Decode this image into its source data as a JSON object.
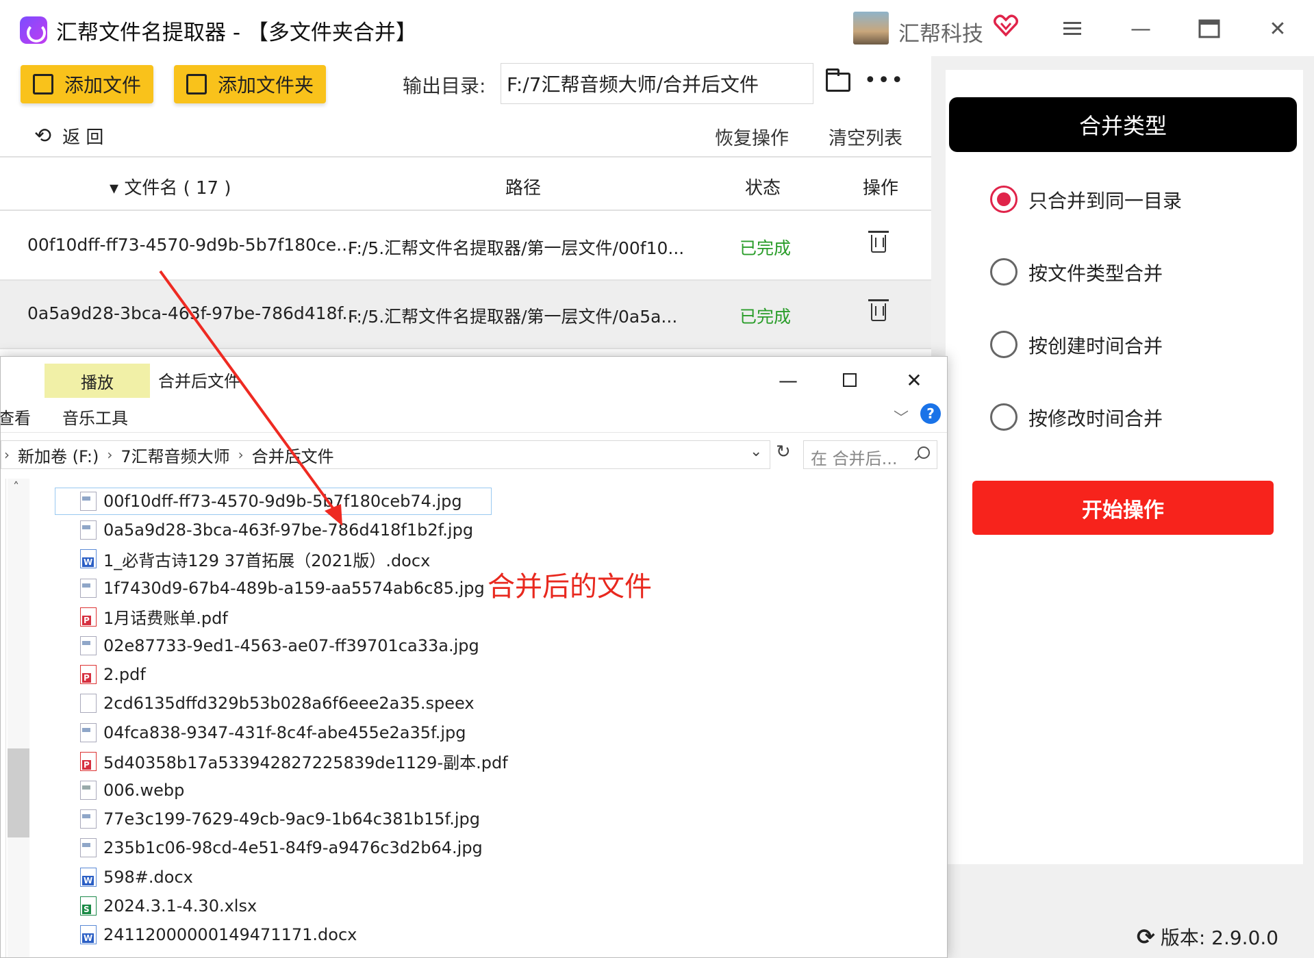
{
  "app": {
    "title": "汇帮文件名提取器 - 【多文件夹合并】",
    "brand": "汇帮科技",
    "window_minimize": "—",
    "window_close": "✕"
  },
  "toolbar": {
    "add_file": "添加文件",
    "add_folder": "添加文件夹",
    "output_label": "输出目录:",
    "output_path": "F:/7汇帮音频大师/合并后文件",
    "more": "•••",
    "back": "返  回",
    "restore": "恢复操作",
    "clear": "清空列表"
  },
  "table": {
    "headers": {
      "name": "▾ 文件名 ( 17 )",
      "path": "路径",
      "status": "状态",
      "action": "操作"
    },
    "rows": [
      {
        "name": "00f10dff-ff73-4570-9d9b-5b7f180ce...",
        "path": "F:/5.汇帮文件名提取器/第一层文件/00f10...",
        "status": "已完成"
      },
      {
        "name": "0a5a9d28-3bca-463f-97be-786d418f...",
        "path": "F:/5.汇帮文件名提取器/第一层文件/0a5a...",
        "status": "已完成"
      }
    ]
  },
  "right_panel": {
    "merge_type_title": "合并类型",
    "options": [
      {
        "label": "只合并到同一目录",
        "selected": true
      },
      {
        "label": "按文件类型合并",
        "selected": false
      },
      {
        "label": "按创建时间合并",
        "selected": false
      },
      {
        "label": "按修改时间合并",
        "selected": false
      }
    ],
    "start_button": "开始操作",
    "version": "版本: 2.9.0.0"
  },
  "explorer": {
    "tab_play": "播放",
    "tab_music_tools": "音乐工具",
    "tab_view": "查看",
    "window_title": "合并后文件",
    "window_minimize": "—",
    "window_close": "✕",
    "help": "?",
    "breadcrumb": [
      "新加卷 (F:)",
      "7汇帮音频大师",
      "合并后文件"
    ],
    "search_placeholder": "在 合并后...",
    "files": [
      {
        "name": "00f10dff-ff73-4570-9d9b-5b7f180ceb74.jpg",
        "type": "jpg"
      },
      {
        "name": "0a5a9d28-3bca-463f-97be-786d418f1b2f.jpg",
        "type": "jpg"
      },
      {
        "name": "1_必背古诗129 37首拓展（2021版）.docx",
        "type": "docx"
      },
      {
        "name": "1f7430d9-67b4-489b-a159-aa5574ab6c85.jpg",
        "type": "jpg"
      },
      {
        "name": "1月话费账单.pdf",
        "type": "pdf"
      },
      {
        "name": "02e87733-9ed1-4563-ae07-ff39701ca33a.jpg",
        "type": "jpg"
      },
      {
        "name": "2.pdf",
        "type": "pdf"
      },
      {
        "name": "2cd6135dffd329b53b028a6f6eee2a35.speex",
        "type": "blank"
      },
      {
        "name": "04fca838-9347-431f-8c4f-abe455e2a35f.jpg",
        "type": "jpg"
      },
      {
        "name": "5d40358b17a533942827225839de1129-副本.pdf",
        "type": "pdf"
      },
      {
        "name": "006.webp",
        "type": "webp"
      },
      {
        "name": "77e3c199-7629-49cb-9ac9-1b64c381b15f.jpg",
        "type": "jpg"
      },
      {
        "name": "235b1c06-98cd-4e51-84f9-a9476c3d2b64.jpg",
        "type": "jpg"
      },
      {
        "name": "598#.docx",
        "type": "docx"
      },
      {
        "name": "2024.3.1-4.30.xlsx",
        "type": "xlsx"
      },
      {
        "name": "24112000000149471171.docx",
        "type": "docx"
      }
    ]
  },
  "annotation": {
    "text": "合并后的文件",
    "color": "#e8281e"
  },
  "colors": {
    "accent_yellow": "#f9c21b",
    "start_red": "#f7231c",
    "radio_selected": "#e0244a",
    "status_green": "#2a9d2a"
  }
}
